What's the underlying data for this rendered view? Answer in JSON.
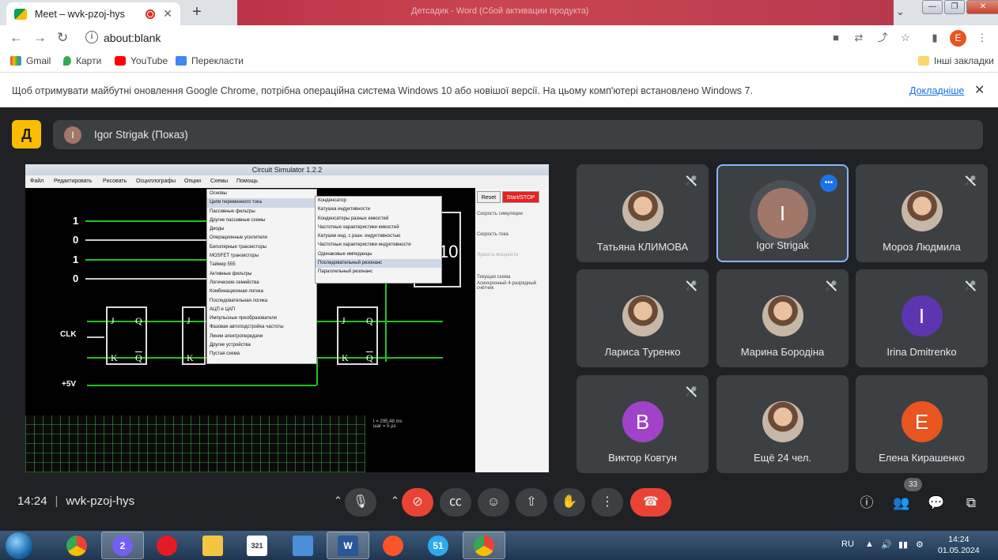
{
  "browser": {
    "tab_title": "Meet – wvk-pzoj-hys",
    "background_tab_text": "Детсадик - Word (Сбой активации продукта)",
    "url": "about:blank",
    "bookmarks": [
      "Gmail",
      "Карти",
      "YouTube",
      "Перекласти"
    ],
    "other_bookmarks": "Інші закладки",
    "profile_initial": "E"
  },
  "infobar": {
    "message": "Щоб отримувати майбутні оновлення Google Chrome, потрібна операційна система Windows 10 або новішої версії. На цьому комп'ютері встановлено Windows 7.",
    "link": "Докладніше"
  },
  "meet": {
    "presenter_initial": "I",
    "presenter_label": "Igor Strigak (Показ)",
    "meeting_time": "14:24",
    "meeting_code": "wvk-pzoj-hys",
    "people_count": "33",
    "participants": [
      {
        "name": "Татьяна КЛИМОВА",
        "initial": "",
        "color": "#8a6e5a",
        "muted": true,
        "photo": true
      },
      {
        "name": "Igor Strigak",
        "initial": "I",
        "color": "#a1776a",
        "muted": false,
        "speaking": true
      },
      {
        "name": "Мороз Людмила",
        "initial": "",
        "color": "#d9a28c",
        "muted": true,
        "photo": true
      },
      {
        "name": "Лариса Туренко",
        "initial": "",
        "color": "#a38a7a",
        "muted": true,
        "photo": true
      },
      {
        "name": "Марина Бородіна",
        "initial": "",
        "color": "#b07950",
        "muted": true,
        "photo": true
      },
      {
        "name": "Irina Dmitrenko",
        "initial": "I",
        "color": "#5e35b1",
        "muted": true
      },
      {
        "name": "Виктор Ковтун",
        "initial": "B",
        "color": "#a142c9",
        "muted": true
      },
      {
        "name": "Ещё 24 чел.",
        "initial": "",
        "color": "#5f6368",
        "muted": false,
        "photo": true
      },
      {
        "name": "Елена Кирашенко",
        "initial": "E",
        "color": "#e8551e",
        "muted": false
      }
    ]
  },
  "shared_screen": {
    "window_title": "Circuit Simulator 1.2.2",
    "menus": [
      "Файл",
      "Редактировать",
      "Рисовать",
      "Осциллографы",
      "Опции",
      "Схемы",
      "Помощь"
    ],
    "logic_inputs": [
      "1",
      "0",
      "1",
      "0"
    ],
    "clk_label": "CLK",
    "power_label": "+5V",
    "display_value": "10",
    "reset_label": "Reset",
    "run_label": "Start/STOP",
    "sim_speed_label": "Скорость симуляции",
    "current_speed_label": "Скорость тока",
    "power_bright_label": "Яркость мощности",
    "current_circuit_label": "Текущая схема",
    "current_circuit_name": "Асинхронный 4-разрядный счётчик",
    "time_info": "t = 295.48 ms",
    "step_info": "шаг = 5 µs",
    "ff_labels": {
      "j": "J",
      "k": "K",
      "q": "Q",
      "qbar": "Q"
    },
    "menu_main": [
      "Основы",
      "Цепи переменного тока",
      "Пассивные фильтры",
      "Другие пассивные схемы",
      "Диоды",
      "Операционные усилители",
      "Биполярные транзисторы",
      "MOSFET транзисторы",
      "Таймер 555",
      "Активные фильтры",
      "Логические семейства",
      "Комбинационная логика",
      "Последовательная логика",
      "АЦП и ЦАП",
      "Импульсные преобразователи",
      "Фазовая автоподстройка частоты",
      "Линии электропередачи",
      "Другие устройства",
      "Пустая схема"
    ],
    "menu_sub": [
      "Конденсатор",
      "Катушка индуктивности",
      "Конденсаторы разных емкостей",
      "Частотные характеристики емкостей",
      "Катушки инд. с разн. индуктивностью",
      "Частотные характеристики индуктивности",
      "Одинаковые импеданцы",
      "Последовательный резонанс",
      "Параллельный резонанс"
    ]
  },
  "taskbar": {
    "apps": [
      "Chrome",
      "Viber",
      "Opera",
      "Explorer",
      "Calendar",
      "Network",
      "Word",
      "Brave",
      "Telegram",
      "Chrome"
    ],
    "viber_badge": "2",
    "telegram_badge": "51",
    "language": "RU",
    "time": "14:24",
    "date": "01.05.2024"
  }
}
